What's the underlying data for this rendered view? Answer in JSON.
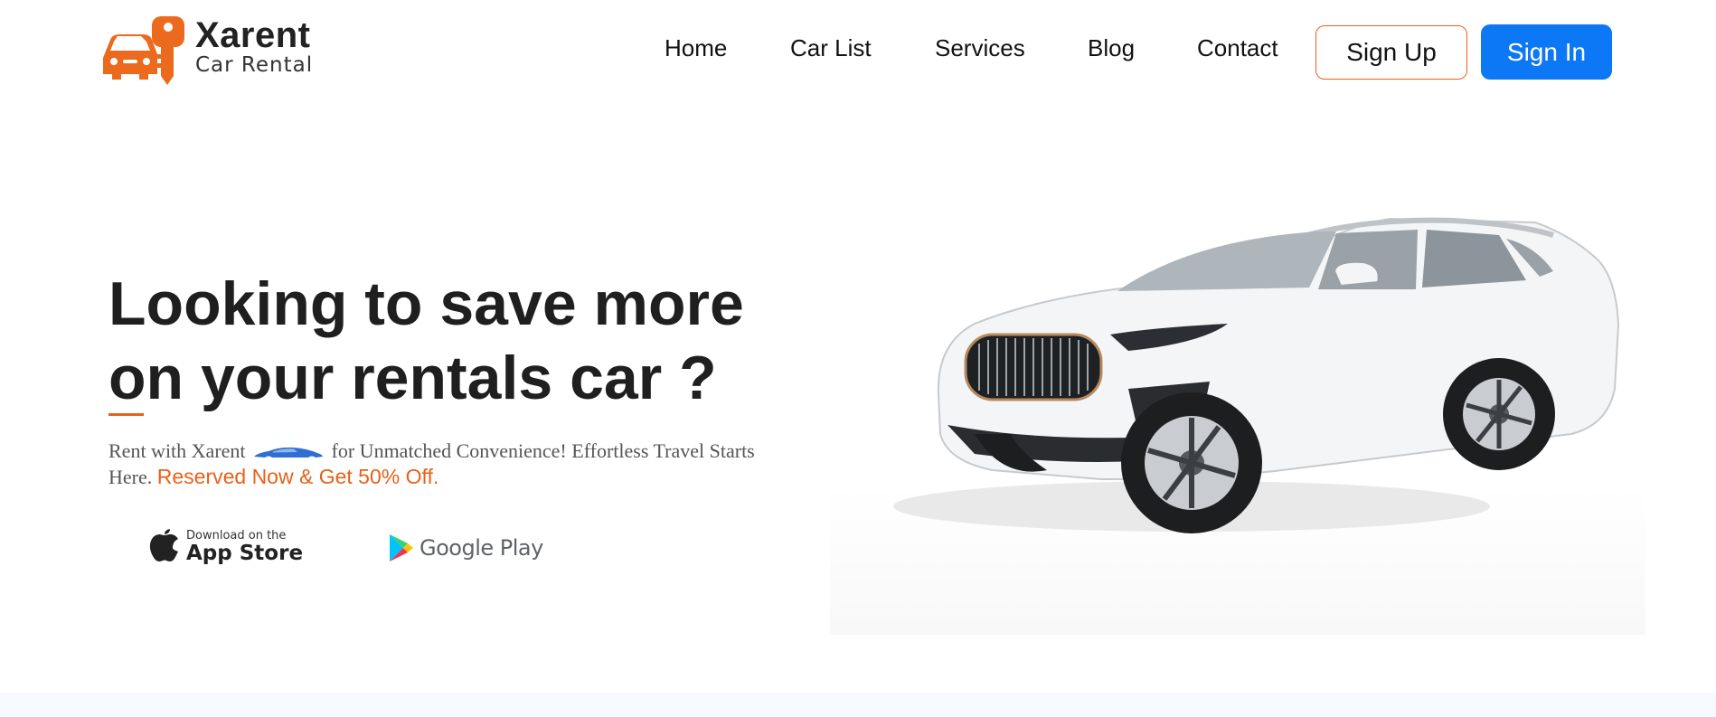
{
  "brand": {
    "name": "Xarent",
    "tagline": "Car Rental",
    "accent_color": "#e8611a",
    "primary_color": "#0c78f5",
    "logo_icon": "car-key-logo-icon"
  },
  "nav": {
    "items": [
      {
        "label": "Home"
      },
      {
        "label": "Car List"
      },
      {
        "label": "Services"
      },
      {
        "label": "Blog"
      },
      {
        "label": "Contact"
      }
    ],
    "signup_label": "Sign Up",
    "signin_label": "Sign In"
  },
  "hero": {
    "title_line1": "Looking to save more",
    "title_line2": "on your rentals car ?",
    "desc_part1": "Rent with Xarent",
    "desc_part2": "for Unmatched Convenience! Effortless Travel Starts Here.",
    "promo": "Reserved Now & Get 50% Off.",
    "image_alt": "white-suv-image"
  },
  "stores": {
    "appstore_small": "Download on the",
    "appstore_big": "App Store",
    "googleplay": "Google Play"
  }
}
